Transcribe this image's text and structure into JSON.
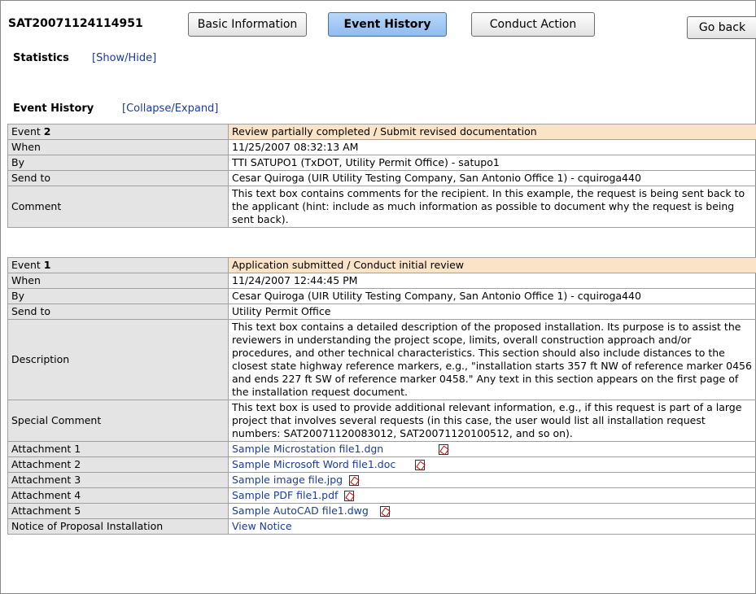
{
  "header": {
    "request_id": "SAT20071124114951",
    "buttons": {
      "basic": "Basic Information",
      "event": "Event History",
      "conduct": "Conduct Action",
      "goback": "Go back"
    }
  },
  "statistics": {
    "title": "Statistics",
    "toggle": "[Show/Hide]"
  },
  "event_history": {
    "title": "Event History",
    "toggle": "[Collapse/Expand]"
  },
  "events": [
    {
      "event_label": "Event",
      "number": "2",
      "status": "Review partially completed / Submit revised documentation",
      "when_label": "When",
      "when": "11/25/2007 08:32:13 AM",
      "by_label": "By",
      "by": "TTI SATUPO1 (TxDOT, Utility Permit Office) - satupo1",
      "sendto_label": "Send to",
      "sendto": "Cesar Quiroga (UIR Utility Testing Company, San Antonio Office 1) - cquiroga440",
      "comment_label": "Comment",
      "comment": "This text box contains comments for the recipient. In this example, the request is being sent back to the applicant (hint: include as much information as possible to document why the request is being sent back)."
    },
    {
      "event_label": "Event",
      "number": "1",
      "status": "Application submitted / Conduct initial review",
      "when_label": "When",
      "when": "11/24/2007 12:44:45 PM",
      "by_label": "By",
      "by": "Cesar Quiroga (UIR Utility Testing Company, San Antonio Office 1) - cquiroga440",
      "sendto_label": "Send to",
      "sendto": "Utility Permit Office",
      "description_label": "Description",
      "description": "This text box contains a detailed description of the proposed installation. Its purpose is to assist the reviewers in understanding the project scope, limits, overall construction approach and/or procedures, and other technical characteristics. This section should also include distances to the closest state highway reference markers, e.g., \"installation starts 357 ft NW of reference marker 0456 and ends 227 ft SW of reference marker 0458.\" Any text in this section appears on the first page of the installation request document.",
      "special_label": "Special Comment",
      "special": "This text box is used to provide additional relevant information, e.g., if this request is part of a large project that involves several requests (in this case, the user would list all installation request numbers: SAT20071120083012, SAT20071120100512, and so on).",
      "attachments": [
        {
          "label": "Attachment 1",
          "file": "Sample Microstation file1.dgn"
        },
        {
          "label": "Attachment 2",
          "file": "Sample Microsoft Word file1.doc"
        },
        {
          "label": "Attachment 3",
          "file": "Sample image file.jpg"
        },
        {
          "label": "Attachment 4",
          "file": "Sample PDF file1.pdf"
        },
        {
          "label": "Attachment 5",
          "file": "Sample AutoCAD file1.dwg"
        }
      ],
      "notice_label": "Notice of Proposal Installation",
      "notice_link": "View Notice"
    }
  ],
  "icons": {
    "attachment": "pdf-icon"
  }
}
